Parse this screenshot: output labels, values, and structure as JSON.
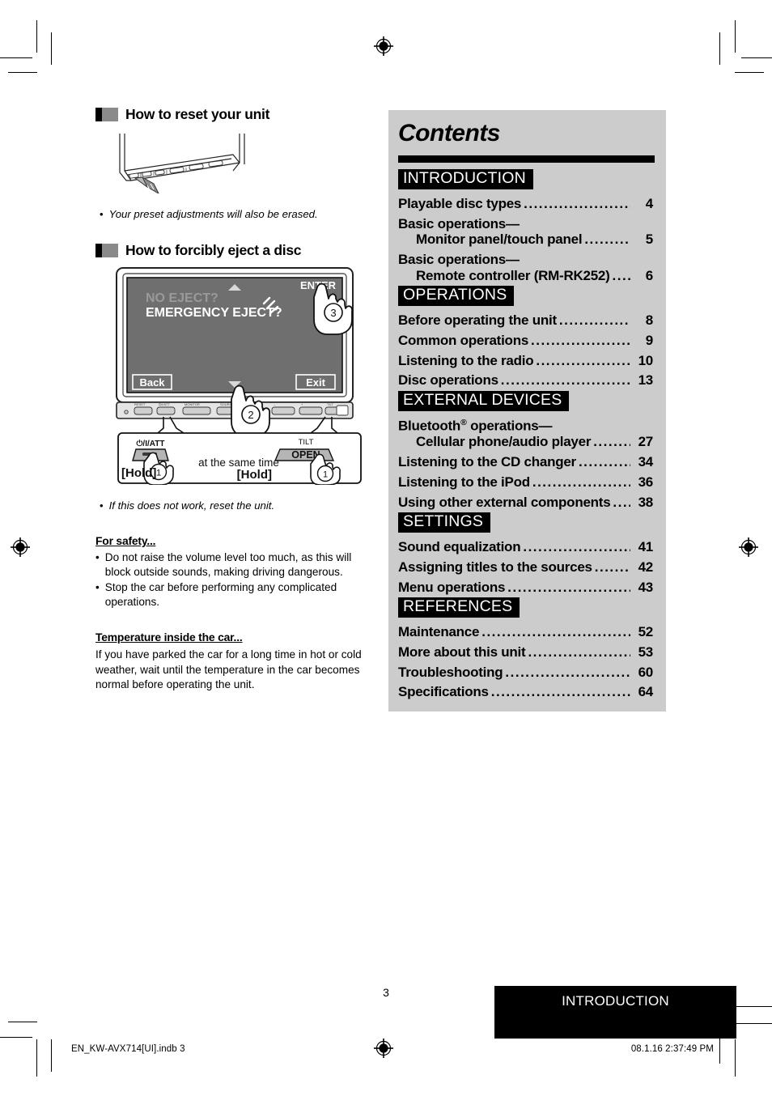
{
  "page": {
    "number": "3",
    "footer_tab": "INTRODUCTION",
    "file_label": "EN_KW-AVX714[UI].indb   3",
    "time_label": "08.1.16   2:37:49 PM"
  },
  "left": {
    "reset": {
      "heading": "How to reset your unit",
      "note_bullet": "•",
      "note": "Your preset adjustments will also be erased."
    },
    "eject": {
      "heading": "How to forcibly eject a disc",
      "screen": {
        "line1": "NO EJECT?",
        "line2": "EMERGENCY EJECT?",
        "enter_label": "ENTER",
        "back_label": "Back",
        "exit_label": "Exit",
        "step_enter": "3",
        "step_down": "2"
      },
      "callout": {
        "power_label": "⏻/I/ATT",
        "tilt_label": "TILT",
        "open_label": "OPEN",
        "middle_text": "at the same time",
        "hold_left": "[Hold]",
        "hold_right": "[Hold]",
        "step_left": "1",
        "step_right": "1"
      },
      "note_bullet": "•",
      "note": "If this does not work, reset the unit."
    },
    "safety": {
      "heading": "For safety...",
      "bullet": "•",
      "items": [
        "Do not raise the volume level too much, as this will block outside sounds, making driving dangerous.",
        "Stop the car before performing any complicated operations."
      ]
    },
    "temperature": {
      "heading": "Temperature inside the car...",
      "body": "If you have parked the car for a long time in hot or cold weather, wait until the temperature in the car becomes normal before operating the unit."
    }
  },
  "contents": {
    "title": "Contents",
    "sections": [
      {
        "category": "INTRODUCTION",
        "entries": [
          {
            "label": "Playable disc types",
            "page": "4",
            "wrap": null
          },
          {
            "label": "Basic operations—",
            "wrap": "Monitor panel/touch panel",
            "page": "5"
          },
          {
            "label": "Basic operations—",
            "wrap": "Remote controller (RM-RK252)",
            "page": "6"
          }
        ]
      },
      {
        "category": "OPERATIONS",
        "entries": [
          {
            "label": "Before operating the unit",
            "page": "8",
            "wrap": null
          },
          {
            "label": "Common operations",
            "page": "9",
            "wrap": null
          },
          {
            "label": "Listening to the radio",
            "page": "10",
            "wrap": null
          },
          {
            "label": "Disc operations",
            "page": "13",
            "wrap": null
          }
        ]
      },
      {
        "category": "EXTERNAL DEVICES",
        "entries": [
          {
            "label": "Bluetooth® operations—",
            "wrap": "Cellular phone/audio player",
            "page": "27"
          },
          {
            "label": "Listening to the CD changer",
            "page": "34",
            "wrap": null
          },
          {
            "label": "Listening to the iPod",
            "page": "36",
            "wrap": null
          },
          {
            "label": "Using other external components",
            "page": "38",
            "wrap": null
          }
        ]
      },
      {
        "category": "SETTINGS",
        "entries": [
          {
            "label": "Sound equalization",
            "page": "41",
            "wrap": null
          },
          {
            "label": "Assigning titles to the sources",
            "page": "42",
            "wrap": null
          },
          {
            "label": "Menu operations",
            "page": "43",
            "wrap": null
          }
        ]
      },
      {
        "category": "REFERENCES",
        "entries": [
          {
            "label": "Maintenance",
            "page": "52",
            "wrap": null
          },
          {
            "label": "More about this unit",
            "page": "53",
            "wrap": null
          },
          {
            "label": "Troubleshooting",
            "page": "60",
            "wrap": null
          },
          {
            "label": "Specifications",
            "page": "64",
            "wrap": null
          }
        ]
      }
    ],
    "leader_dots": "........................................................................",
    "colors": {
      "panel_bg": "#cccccc",
      "category_bg": "#000000",
      "category_fg": "#ffffff"
    }
  }
}
